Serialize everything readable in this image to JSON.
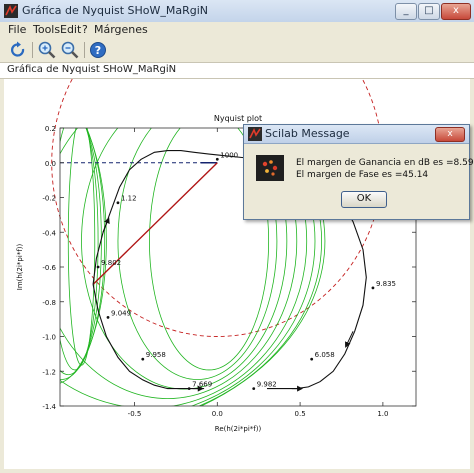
{
  "window": {
    "title": "Gráfica de Nyquist SHoW_MaRgiN",
    "buttons": {
      "minimize": "_",
      "maximize": "□",
      "close": "x"
    }
  },
  "menu": {
    "items": [
      "File",
      "Tools",
      "Edit",
      "?",
      "Márgenes"
    ]
  },
  "toolbar": {
    "icons": [
      "rotate-icon",
      "zoom-in-icon",
      "zoom-out-icon",
      "help-icon"
    ]
  },
  "document": {
    "title": "Gráfica de Nyquist SHoW_MaRgiN"
  },
  "plot": {
    "title": "Nyquist plot",
    "xlabel": "Re(h(2i*pi*f))",
    "ylabel": "Im(h(2i*pi*f))",
    "colors": {
      "curve": "#111111",
      "grid_curves": "#21b521",
      "unit_circle": "#c52020",
      "phase_line": "#b01515",
      "gain_line": "#14236e"
    }
  },
  "chart_data": {
    "type": "line",
    "title": "Nyquist plot",
    "xlabel": "Re(h(2i*pi*f))",
    "ylabel": "Im(h(2i*pi*f))",
    "xlim": [
      -0.95,
      1.2
    ],
    "ylim": [
      -1.4,
      0.2
    ],
    "x_ticks": [
      -0.5,
      0.0,
      0.5,
      1.0
    ],
    "y_ticks": [
      0.2,
      0.0,
      -0.2,
      -0.4,
      -0.6,
      -0.8,
      -1.0,
      -1.2,
      -1.4
    ],
    "x_tick_labels": [
      "-0.5",
      "0.0",
      "0.5",
      "1.0"
    ],
    "y_tick_labels": [
      "0.2",
      "0.0",
      "-0.2",
      "-0.4",
      "-0.6",
      "-0.8",
      "-1.0",
      "-1.2",
      "-1.4"
    ],
    "grid": false,
    "series": [
      {
        "x": [
          -0.75,
          -0.73,
          -0.69,
          -0.64,
          -0.59,
          -0.53,
          -0.46,
          -0.38,
          -0.3,
          -0.22,
          -0.14,
          -0.05,
          0.05,
          0.15,
          0.25,
          0.35,
          0.45,
          0.55,
          0.65,
          0.74,
          0.82,
          0.88,
          0.9,
          0.88,
          0.83,
          0.77,
          0.7,
          0.62,
          0.55,
          0.48,
          0.42,
          0.37,
          0.33,
          0.3
        ],
        "y": [
          -0.7,
          -0.55,
          -0.4,
          -0.27,
          -0.14,
          -0.04,
          0.02,
          0.06,
          0.07,
          0.07,
          0.06,
          0.05,
          0.04,
          0.03,
          0.02,
          0.01,
          -0.01,
          -0.04,
          -0.1,
          -0.2,
          -0.34,
          -0.5,
          -0.66,
          -0.82,
          -0.97,
          -1.1,
          -1.2,
          -1.26,
          -1.29,
          -1.3,
          -1.3,
          -1.3,
          -1.3,
          -1.3
        ]
      },
      {
        "x": [
          -0.75,
          -0.72,
          -0.67,
          -0.6,
          -0.53,
          -0.45,
          -0.38,
          -0.3,
          -0.22,
          -0.14,
          -0.08
        ],
        "y": [
          -0.7,
          -0.85,
          -1.0,
          -1.12,
          -1.2,
          -1.25,
          -1.28,
          -1.3,
          -1.3,
          -1.3,
          -1.3
        ]
      }
    ],
    "point_labels": [
      {
        "text": "1000",
        "x": 0.0,
        "y": 0.02
      },
      {
        "text": "1.12",
        "x": -0.6,
        "y": -0.23
      },
      {
        "text": "9.802",
        "x": -0.72,
        "y": -0.6
      },
      {
        "text": "9.049",
        "x": -0.66,
        "y": -0.89
      },
      {
        "text": "9.958",
        "x": -0.45,
        "y": -1.13
      },
      {
        "text": "7.669",
        "x": -0.17,
        "y": -1.3
      },
      {
        "text": "9.982",
        "x": 0.22,
        "y": -1.3
      },
      {
        "text": "6.058",
        "x": 0.57,
        "y": -1.13
      },
      {
        "text": "9.835",
        "x": 0.94,
        "y": -0.72
      }
    ]
  },
  "dialog": {
    "title": "Scilab Message",
    "close_label": "x",
    "line1": "El margen de Ganancia en dB es =8.592",
    "line2": "El margen de Fase es =45.14",
    "ok_label": "OK"
  }
}
